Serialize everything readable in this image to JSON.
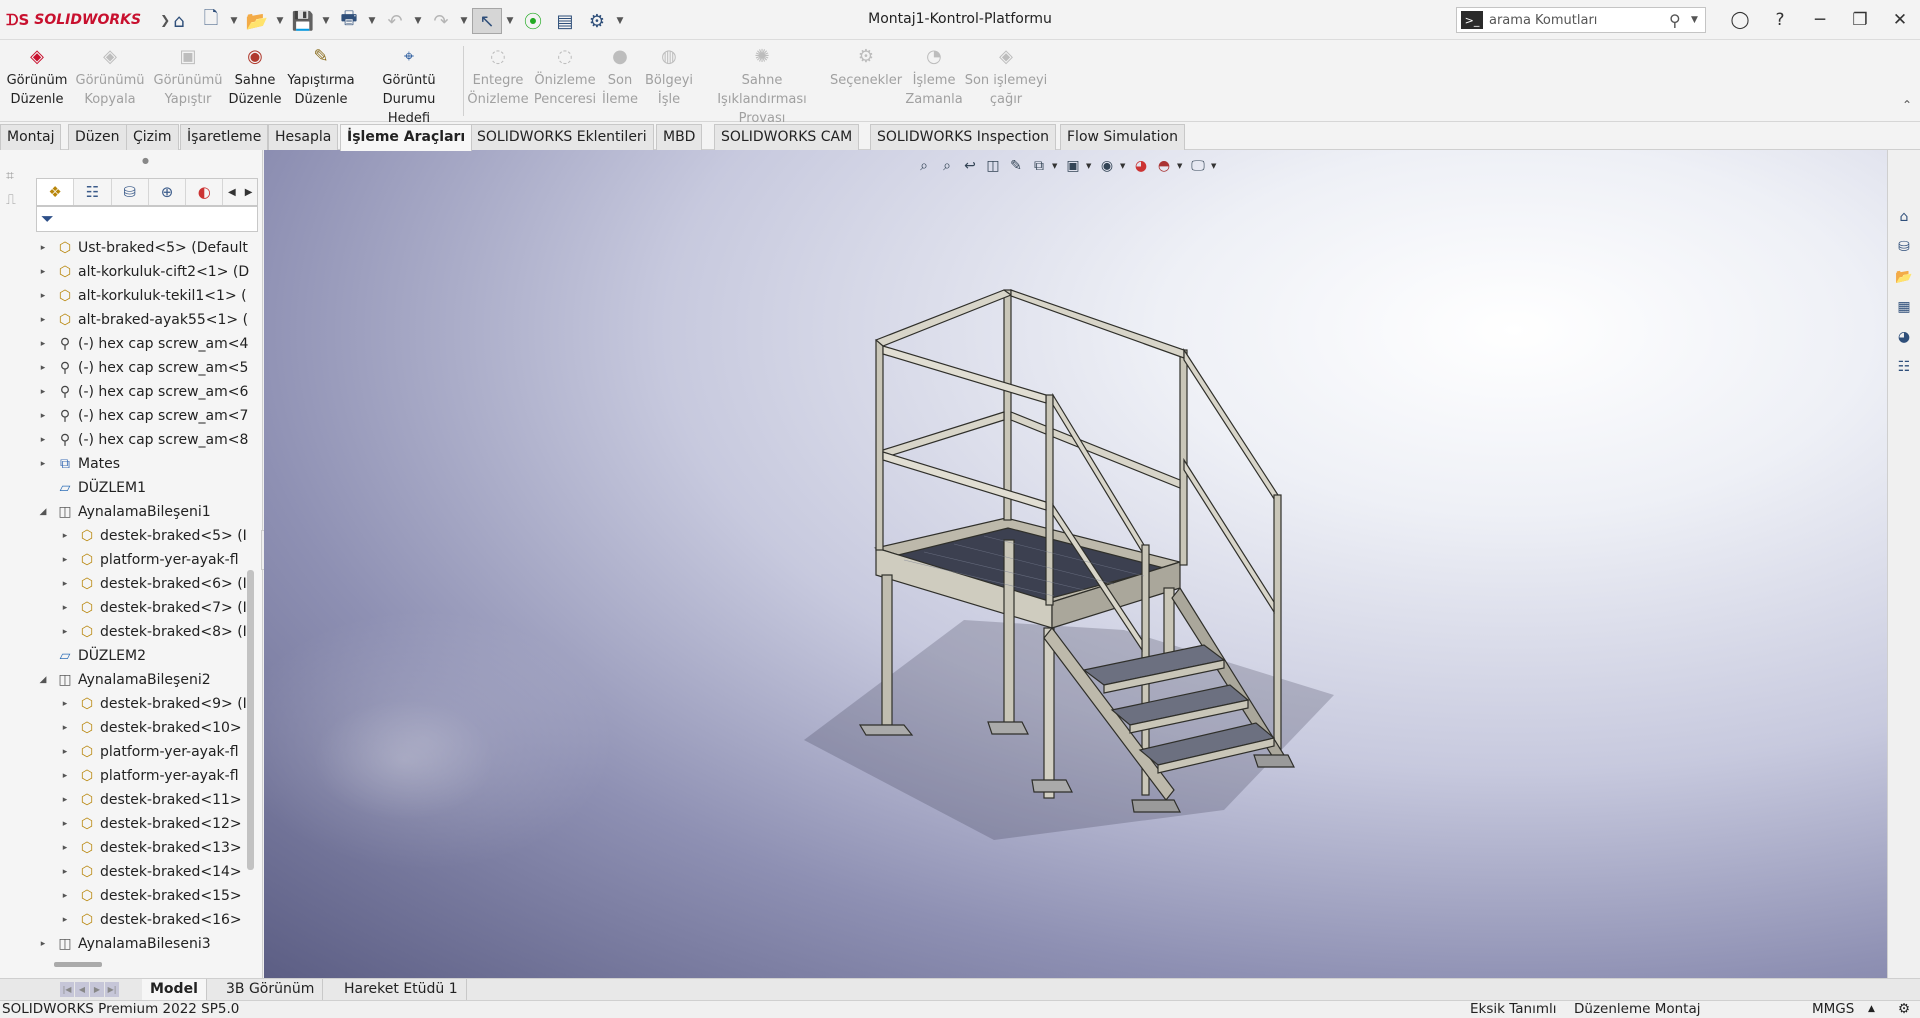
{
  "app": {
    "title": "Montaj1-Kontrol-Platformu",
    "brand": "SOLIDWORKS"
  },
  "search": {
    "placeholder": "arama Komutları"
  },
  "ribbon": {
    "buttons": [
      {
        "label": "Görünüm Düzenle",
        "icon": "view-edit-icon",
        "enabled": true
      },
      {
        "label": "Görünümü Kopyala",
        "icon": "copy-view-icon",
        "enabled": false
      },
      {
        "label": "Görünümü Yapıştır",
        "icon": "paste-view-icon",
        "enabled": false
      },
      {
        "label": "Sahne Düzenle",
        "icon": "scene-edit-icon",
        "enabled": true
      },
      {
        "label": "Yapıştırma Düzenle",
        "icon": "decal-edit-icon",
        "enabled": true
      },
      {
        "label": "Görüntü Durumu Hedefi",
        "icon": "target-icon",
        "enabled": true
      },
      {
        "label": "Entegre Önizleme",
        "icon": "integrated-preview-icon",
        "enabled": false
      },
      {
        "label": "Önizleme Penceresi",
        "icon": "preview-window-icon",
        "enabled": false
      },
      {
        "label": "Son İleme",
        "icon": "final-render-icon",
        "enabled": false
      },
      {
        "label": "Bölgeyi İşle",
        "icon": "render-region-icon",
        "enabled": false
      },
      {
        "label": "Sahne Işıklandırması Provası",
        "icon": "lighting-icon",
        "enabled": false
      },
      {
        "label": "Seçenekler",
        "icon": "options-icon",
        "enabled": false
      },
      {
        "label": "İşleme Zamanla",
        "icon": "schedule-icon",
        "enabled": false
      },
      {
        "label": "Son işlemeyi çağır",
        "icon": "recall-render-icon",
        "enabled": false
      }
    ]
  },
  "tabs": [
    {
      "label": "Montaj",
      "active": false
    },
    {
      "label": "Düzen",
      "active": false
    },
    {
      "label": "Çizim",
      "active": false
    },
    {
      "label": "İşaretleme",
      "active": false
    },
    {
      "label": "Hesapla",
      "active": false
    },
    {
      "label": "İşleme Araçları",
      "active": true
    },
    {
      "label": "SOLIDWORKS Eklentileri",
      "active": false
    },
    {
      "label": "MBD",
      "active": false
    },
    {
      "label": "SOLIDWORKS CAM",
      "active": false
    },
    {
      "label": "SOLIDWORKS Inspection",
      "active": false
    },
    {
      "label": "Flow Simulation",
      "active": false
    }
  ],
  "tree": [
    {
      "label": "Ust-braked<5> (Default",
      "icon": "part",
      "expander": "collapsed",
      "level": 0
    },
    {
      "label": "alt-korkuluk-cift2<1> (D",
      "icon": "part",
      "expander": "collapsed",
      "level": 0
    },
    {
      "label": "alt-korkuluk-tekil1<1> (",
      "icon": "part",
      "expander": "collapsed",
      "level": 0
    },
    {
      "label": "alt-braked-ayak55<1> (",
      "icon": "part",
      "expander": "collapsed",
      "level": 0
    },
    {
      "label": "(-) hex cap screw_am<4",
      "icon": "screw",
      "expander": "collapsed",
      "level": 0
    },
    {
      "label": "(-) hex cap screw_am<5",
      "icon": "screw",
      "expander": "collapsed",
      "level": 0
    },
    {
      "label": "(-) hex cap screw_am<6",
      "icon": "screw",
      "expander": "collapsed",
      "level": 0
    },
    {
      "label": "(-) hex cap screw_am<7",
      "icon": "screw",
      "expander": "collapsed",
      "level": 0
    },
    {
      "label": "(-) hex cap screw_am<8",
      "icon": "screw",
      "expander": "collapsed",
      "level": 0
    },
    {
      "label": "Mates",
      "icon": "mate",
      "expander": "collapsed",
      "level": 0
    },
    {
      "label": "DÜZLEM1",
      "icon": "plane",
      "expander": "none",
      "level": 0
    },
    {
      "label": "AynalamaBileşeni1",
      "icon": "mirror",
      "expander": "expanded",
      "level": 0
    },
    {
      "label": "destek-braked<5> (I",
      "icon": "part",
      "expander": "collapsed",
      "level": 1
    },
    {
      "label": "platform-yer-ayak-fl",
      "icon": "part",
      "expander": "collapsed",
      "level": 1
    },
    {
      "label": "destek-braked<6> (I",
      "icon": "part",
      "expander": "collapsed",
      "level": 1
    },
    {
      "label": "destek-braked<7> (I",
      "icon": "part",
      "expander": "collapsed",
      "level": 1
    },
    {
      "label": "destek-braked<8> (I",
      "icon": "part",
      "expander": "collapsed",
      "level": 1
    },
    {
      "label": "DÜZLEM2",
      "icon": "plane",
      "expander": "none",
      "level": 0
    },
    {
      "label": "AynalamaBileşeni2",
      "icon": "mirror",
      "expander": "expanded",
      "level": 0
    },
    {
      "label": "destek-braked<9> (I",
      "icon": "part",
      "expander": "collapsed",
      "level": 1
    },
    {
      "label": "destek-braked<10>",
      "icon": "part",
      "expander": "collapsed",
      "level": 1
    },
    {
      "label": "platform-yer-ayak-fl",
      "icon": "part",
      "expander": "collapsed",
      "level": 1
    },
    {
      "label": "platform-yer-ayak-fl",
      "icon": "part",
      "expander": "collapsed",
      "level": 1
    },
    {
      "label": "destek-braked<11>",
      "icon": "part",
      "expander": "collapsed",
      "level": 1
    },
    {
      "label": "destek-braked<12>",
      "icon": "part",
      "expander": "collapsed",
      "level": 1
    },
    {
      "label": "destek-braked<13>",
      "icon": "part",
      "expander": "collapsed",
      "level": 1
    },
    {
      "label": "destek-braked<14>",
      "icon": "part",
      "expander": "collapsed",
      "level": 1
    },
    {
      "label": "destek-braked<15>",
      "icon": "part",
      "expander": "collapsed",
      "level": 1
    },
    {
      "label": "destek-braked<16>",
      "icon": "part",
      "expander": "collapsed",
      "level": 1
    },
    {
      "label": "AynalamaBileseni3",
      "icon": "mirror",
      "expander": "collapsed",
      "level": 0
    }
  ],
  "bottom_tabs": [
    {
      "label": "Model",
      "active": true
    },
    {
      "label": "3B Görünüm",
      "active": false
    },
    {
      "label": "Hareket Etüdü 1",
      "active": false
    }
  ],
  "status": {
    "version": "SOLIDWORKS Premium 2022 SP5.0",
    "definition": "Eksik Tanımlı",
    "mode": "Düzenleme Montaj",
    "units": "MMGS"
  },
  "colors": {
    "brand_red": "#c8102e",
    "icon_blue": "#2f4f7a",
    "viewport_dark": "#5c5e84",
    "viewport_light": "#eef0f6"
  }
}
